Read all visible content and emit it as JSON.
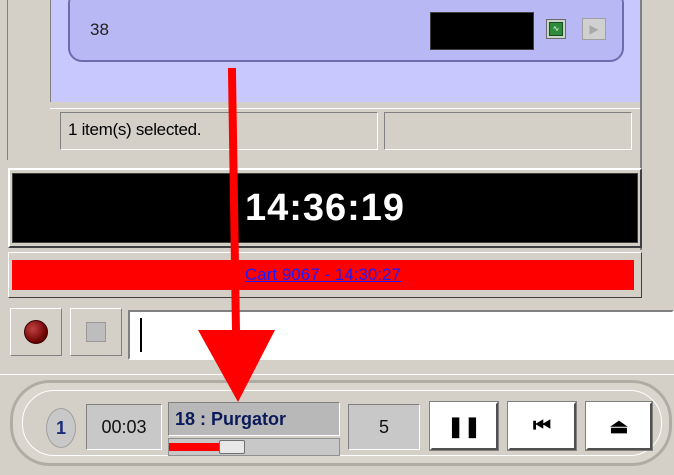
{
  "item_list": {
    "item_number": "38",
    "icon_a": "run-icon",
    "icon_b": "play-icon"
  },
  "status_bar": {
    "selection_text": "1 item(s) selected."
  },
  "clock": {
    "time": "14:36:19"
  },
  "cart_bar": {
    "label": "Cart 9067 - 14:30:27",
    "color": "#ff0000"
  },
  "record_row": {
    "record_icon": "record-icon",
    "stop_icon": "stop-icon",
    "input_value": ""
  },
  "player": {
    "track_number": "1",
    "elapsed": "00:03",
    "title": "18 : Purgator",
    "progress": 0.33,
    "count": "5",
    "pause_label": "❚❚",
    "prev_label": "⏮",
    "eject_label": "⏏"
  },
  "overlay": {
    "arrow_color": "#ff0000"
  }
}
